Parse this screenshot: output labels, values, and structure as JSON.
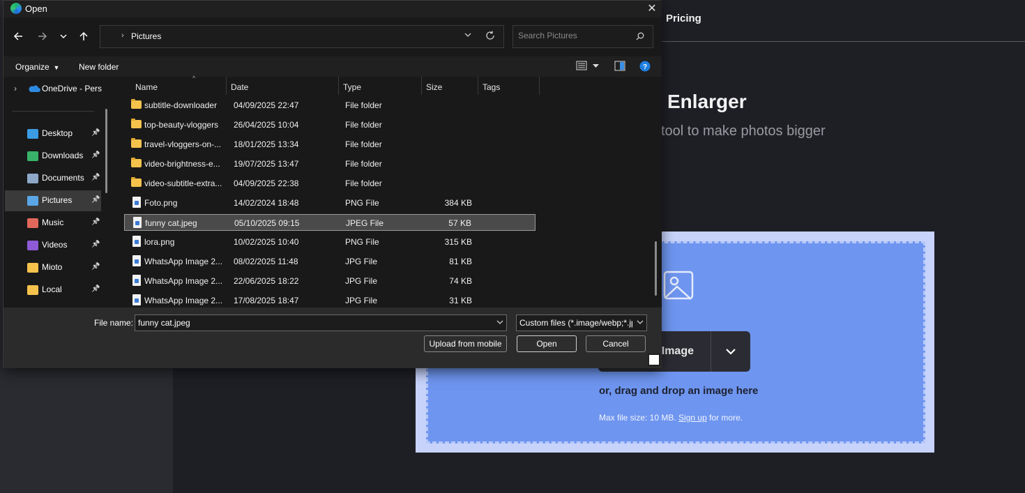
{
  "background_page": {
    "nav": {
      "pricing": "Pricing"
    },
    "hero": {
      "title": "Enlarger",
      "subtitle": "tool to make photos bigger"
    },
    "dropzone": {
      "upload_button": "Image",
      "drag_text": "or, drag and drop an image here",
      "max_size_prefix": "Max file size: 10 MB.",
      "sign_up": "Sign up",
      "max_size_suffix": "for more."
    }
  },
  "dialog": {
    "title": "Open",
    "address": {
      "path": "Pictures"
    },
    "search": {
      "placeholder": "Search Pictures"
    },
    "toolbar": {
      "organize": "Organize",
      "new_folder": "New folder"
    },
    "sidebar": {
      "top": {
        "label": "OneDrive - Perso"
      },
      "items": [
        {
          "label": "Desktop",
          "icon": "desktop-icon",
          "color": "#3b9be3"
        },
        {
          "label": "Downloads",
          "icon": "download-icon",
          "color": "#39b36a"
        },
        {
          "label": "Documents",
          "icon": "document-icon",
          "color": "#8fa8c8"
        },
        {
          "label": "Pictures",
          "icon": "pictures-icon",
          "color": "#5aa6e6",
          "selected": true
        },
        {
          "label": "Music",
          "icon": "music-icon",
          "color": "#e0685a"
        },
        {
          "label": "Videos",
          "icon": "videos-icon",
          "color": "#8e5ad6"
        },
        {
          "label": "Mioto",
          "icon": "folder-icon",
          "color": "#f5c24c"
        },
        {
          "label": "Local",
          "icon": "folder-icon",
          "color": "#f5c24c"
        }
      ]
    },
    "columns": [
      "Name",
      "Date",
      "Type",
      "Size",
      "Tags"
    ],
    "files": [
      {
        "name": "subtitle-downloader",
        "date": "04/09/2025 22:47",
        "type": "File folder",
        "size": "",
        "kind": "folder"
      },
      {
        "name": "top-beauty-vloggers",
        "date": "26/04/2025 10:04",
        "type": "File folder",
        "size": "",
        "kind": "folder"
      },
      {
        "name": "travel-vloggers-on-...",
        "date": "18/01/2025 13:34",
        "type": "File folder",
        "size": "",
        "kind": "folder"
      },
      {
        "name": "video-brightness-e...",
        "date": "19/07/2025 13:47",
        "type": "File folder",
        "size": "",
        "kind": "folder"
      },
      {
        "name": "video-subtitle-extra...",
        "date": "04/09/2025 22:38",
        "type": "File folder",
        "size": "",
        "kind": "folder"
      },
      {
        "name": "Foto.png",
        "date": "14/02/2024 18:48",
        "type": "PNG File",
        "size": "384 KB",
        "kind": "file"
      },
      {
        "name": "funny cat.jpeg",
        "date": "05/10/2025 09:15",
        "type": "JPEG File",
        "size": "57 KB",
        "kind": "file",
        "selected": true
      },
      {
        "name": "lora.png",
        "date": "10/02/2025 10:40",
        "type": "PNG File",
        "size": "315 KB",
        "kind": "file"
      },
      {
        "name": "WhatsApp Image 2...",
        "date": "08/02/2025 11:48",
        "type": "JPG File",
        "size": "81 KB",
        "kind": "file"
      },
      {
        "name": "WhatsApp Image 2...",
        "date": "22/06/2025 18:22",
        "type": "JPG File",
        "size": "74 KB",
        "kind": "file"
      },
      {
        "name": "WhatsApp Image 2...",
        "date": "17/08/2025 18:47",
        "type": "JPG File",
        "size": "31 KB",
        "kind": "file"
      }
    ],
    "footer": {
      "file_name_label": "File name:",
      "file_name_value": "funny cat.jpeg",
      "file_type": "Custom files (*.image/webp;*.jpg",
      "upload_mobile": "Upload from mobile",
      "open": "Open",
      "cancel": "Cancel"
    }
  }
}
